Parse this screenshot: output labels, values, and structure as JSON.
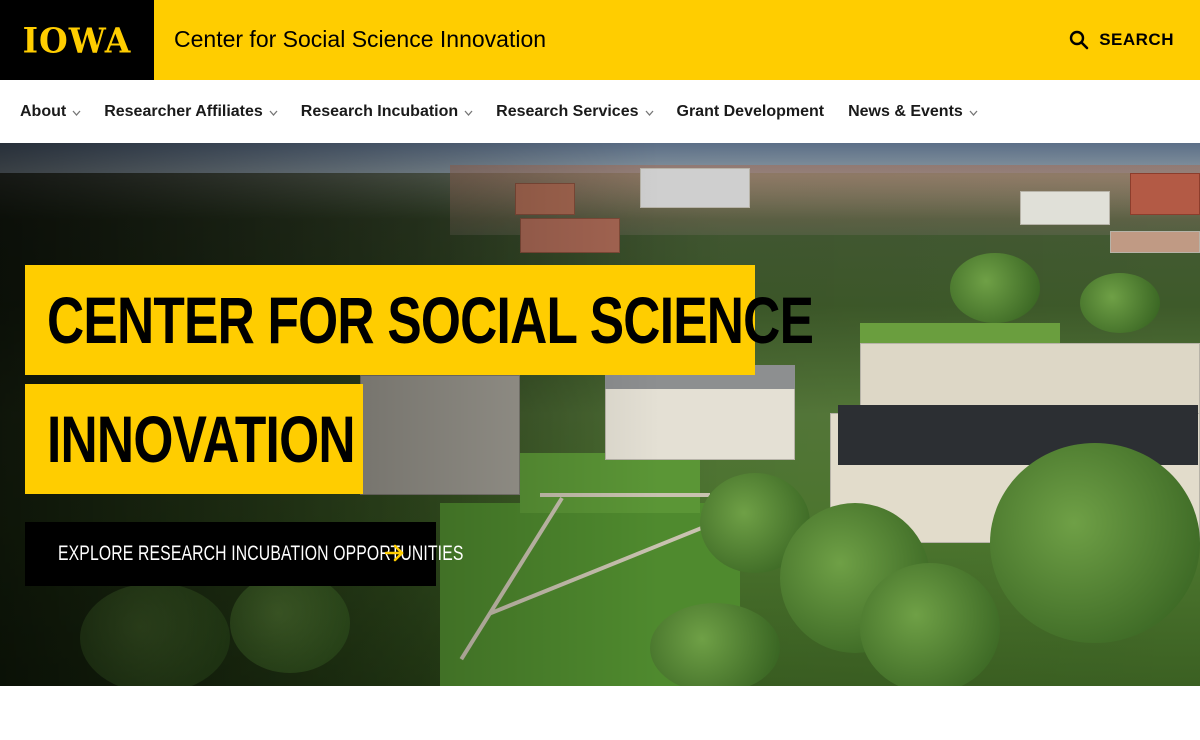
{
  "header": {
    "logo_text": "IOWA",
    "site_title": "Center for Social Science Innovation",
    "search_label": "SEARCH",
    "search_icon": "search-icon",
    "brand_color": "#FFCD00"
  },
  "nav": {
    "items": [
      {
        "label": "About",
        "has_dropdown": true
      },
      {
        "label": "Researcher Affiliates",
        "has_dropdown": true
      },
      {
        "label": "Research Incubation",
        "has_dropdown": true
      },
      {
        "label": "Research Services",
        "has_dropdown": true
      },
      {
        "label": "Grant Development",
        "has_dropdown": false
      },
      {
        "label": "News & Events",
        "has_dropdown": true
      }
    ]
  },
  "hero": {
    "headline_line1": "CENTER FOR SOCIAL SCIENCE",
    "headline_line2": "INNOVATION",
    "cta_label": "EXPLORE RESEARCH INCUBATION OPPORTUNITIES",
    "cta_icon": "arrow-right-icon",
    "image_description_icon": "campus-aerial-photo"
  }
}
